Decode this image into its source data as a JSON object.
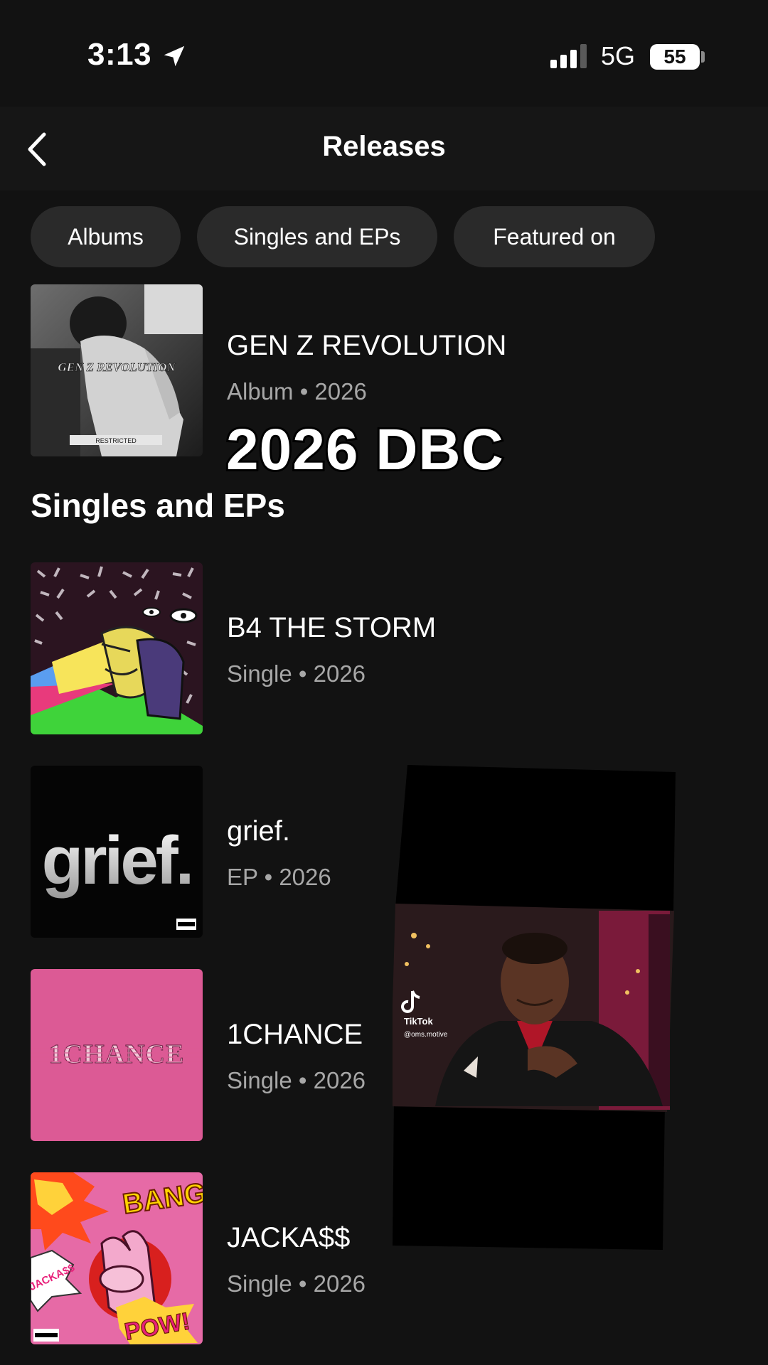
{
  "status": {
    "time": "3:13",
    "network": "5G",
    "battery": "55"
  },
  "nav": {
    "title": "Releases"
  },
  "filters": [
    {
      "label": "Albums"
    },
    {
      "label": "Singles and EPs"
    },
    {
      "label": "Featured on"
    }
  ],
  "album": {
    "title": "GEN Z REVOLUTION",
    "meta": "Album • 2026",
    "cover_text": "GEN Z REVOLUTION",
    "cover_badge": "RESTRICTED"
  },
  "caption": "2026 DBC",
  "section": {
    "title": "Singles and EPs"
  },
  "singles": [
    {
      "title": "B4 THE STORM",
      "meta": "Single • 2026"
    },
    {
      "title": "grief.",
      "meta": "EP • 2026",
      "cover_text": "grief."
    },
    {
      "title": "1CHANCE",
      "meta": "Single • 2026",
      "cover_text": "1CHANCE"
    },
    {
      "title": "JACKA$$",
      "meta": "Single • 2026",
      "cover_words": [
        "BANG",
        "JACKA$$",
        "POW!"
      ]
    }
  ],
  "video": {
    "watermark_brand": "TikTok",
    "watermark_handle": "@oms.motive"
  }
}
